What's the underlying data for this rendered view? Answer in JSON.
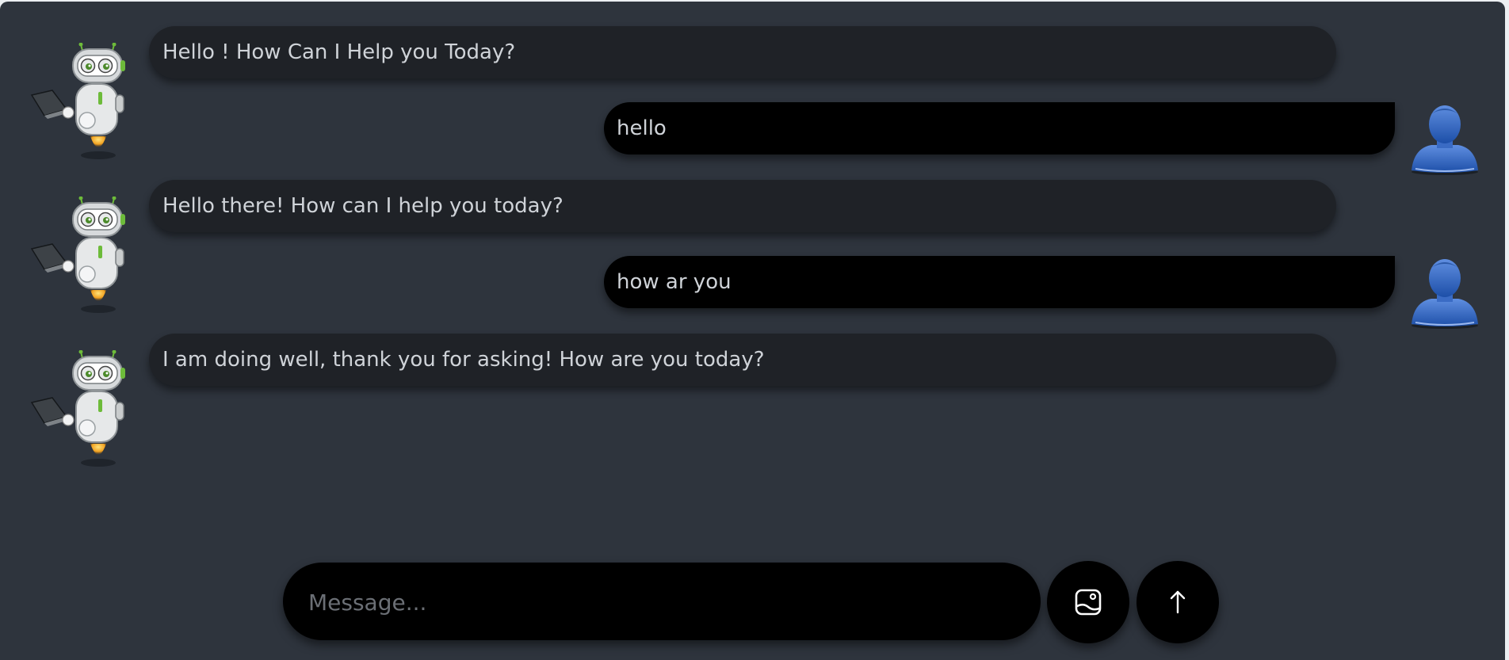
{
  "chat": {
    "messages": [
      {
        "role": "bot",
        "text": "Hello ! How Can I Help you Today?"
      },
      {
        "role": "user",
        "text": "hello"
      },
      {
        "role": "bot",
        "text": "Hello there! How can I help you today?"
      },
      {
        "role": "user",
        "text": "how ar you"
      },
      {
        "role": "bot",
        "text": "I am doing well, thank you for asking! How are you today?"
      }
    ]
  },
  "composer": {
    "placeholder": "Message...",
    "value": "",
    "upload_icon": "image-upload-icon",
    "send_icon": "arrow-up-icon"
  },
  "colors": {
    "background": "#2e343d",
    "bot_bubble": "#1f2227",
    "user_bubble": "#000000",
    "text": "#cfd3d8"
  }
}
